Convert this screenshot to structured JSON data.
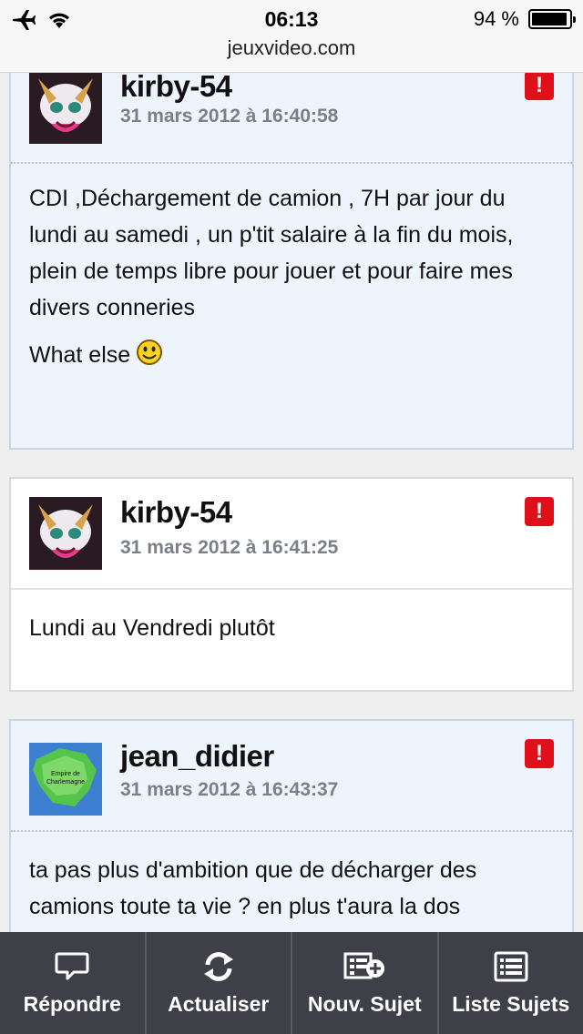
{
  "status_bar": {
    "time": "06:13",
    "battery": "94 %",
    "battery_level": 0.94,
    "url": "jeuxvideo.com"
  },
  "posts": [
    {
      "author": "kirby-54",
      "date": "31 mars 2012 à 16:40:58",
      "paragraphs": [
        "CDI ,Déchargement de camion , 7H par jour du lundi au samedi , un p'tit salaire à la fin du mois, plein de temps libre pour jouer et pour faire mes divers conneries",
        "What else"
      ],
      "avatar_icon": "character-avatar-icon"
    },
    {
      "author": "kirby-54",
      "date": "31 mars 2012 à 16:41:25",
      "paragraphs": [
        "Lundi au Vendredi plutôt"
      ],
      "avatar_icon": "character-avatar-icon"
    },
    {
      "author": "jean_didier",
      "date": "31 mars 2012 à 16:43:37",
      "paragraphs": [
        "ta pas plus d'ambition que de décharger des camions toute ta vie ? en plus t'aura la dos"
      ],
      "avatar_icon": "map-avatar-icon",
      "avatar_map_text": "Empire de Charlemagne"
    }
  ],
  "toolbar": {
    "reply": "Répondre",
    "refresh": "Actualiser",
    "new_topic": "Nouv. Sujet",
    "topic_list": "Liste Sujets"
  },
  "colors": {
    "toolbar_bg": "#3f3f48",
    "alert_red": "#e0101a",
    "post_bg_blue": "#eef4fc",
    "post_bg_white": "#ffffff"
  }
}
